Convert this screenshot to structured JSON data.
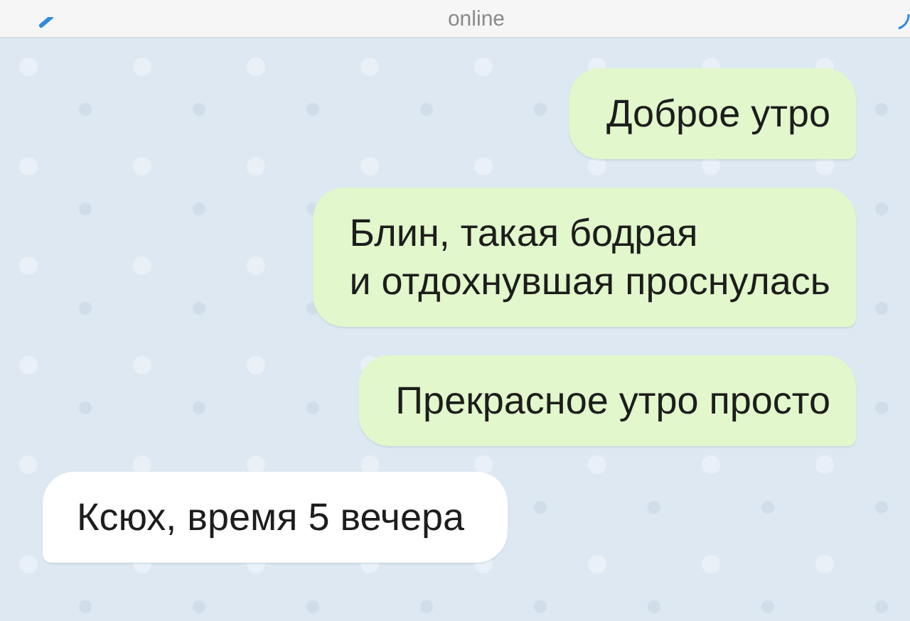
{
  "header": {
    "status": "online"
  },
  "messages": [
    {
      "text": "Доброе утро",
      "kind": "outgoing"
    },
    {
      "text": "Блин, такая бодрая\nи отдохнувшая проснулась",
      "kind": "outgoing"
    },
    {
      "text": "Прекрасное утро просто",
      "kind": "outgoing"
    },
    {
      "text": "Ксюх, время 5 вечера",
      "kind": "incoming"
    }
  ]
}
